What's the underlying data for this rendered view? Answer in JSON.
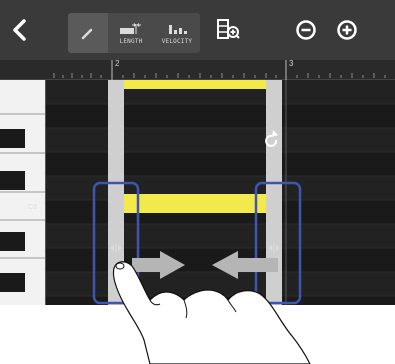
{
  "toolbar": {
    "tools": {
      "length_label": "LENGTH",
      "velocity_label": "VELOCITY"
    }
  },
  "ruler": {
    "bar_2": "2",
    "bar_3": "3"
  },
  "keyboard": {
    "c3_label": "C3"
  },
  "icons": {
    "back": "chevron-left-icon",
    "pencil": "pencil-icon",
    "length": "length-icon",
    "velocity": "velocity-icon",
    "quantize": "quantize-icon",
    "zoom_out": "zoom-out-icon",
    "zoom_in": "zoom-in-icon",
    "redo": "redo-icon",
    "drag_handle": "resize-handle-icon"
  },
  "colors": {
    "toolbar": "#3a3a3a",
    "grid": "#1b1b1b",
    "note": "#f2ea4a",
    "highlight": "#3f56b0",
    "selection_bar": "#d0d0d0"
  }
}
